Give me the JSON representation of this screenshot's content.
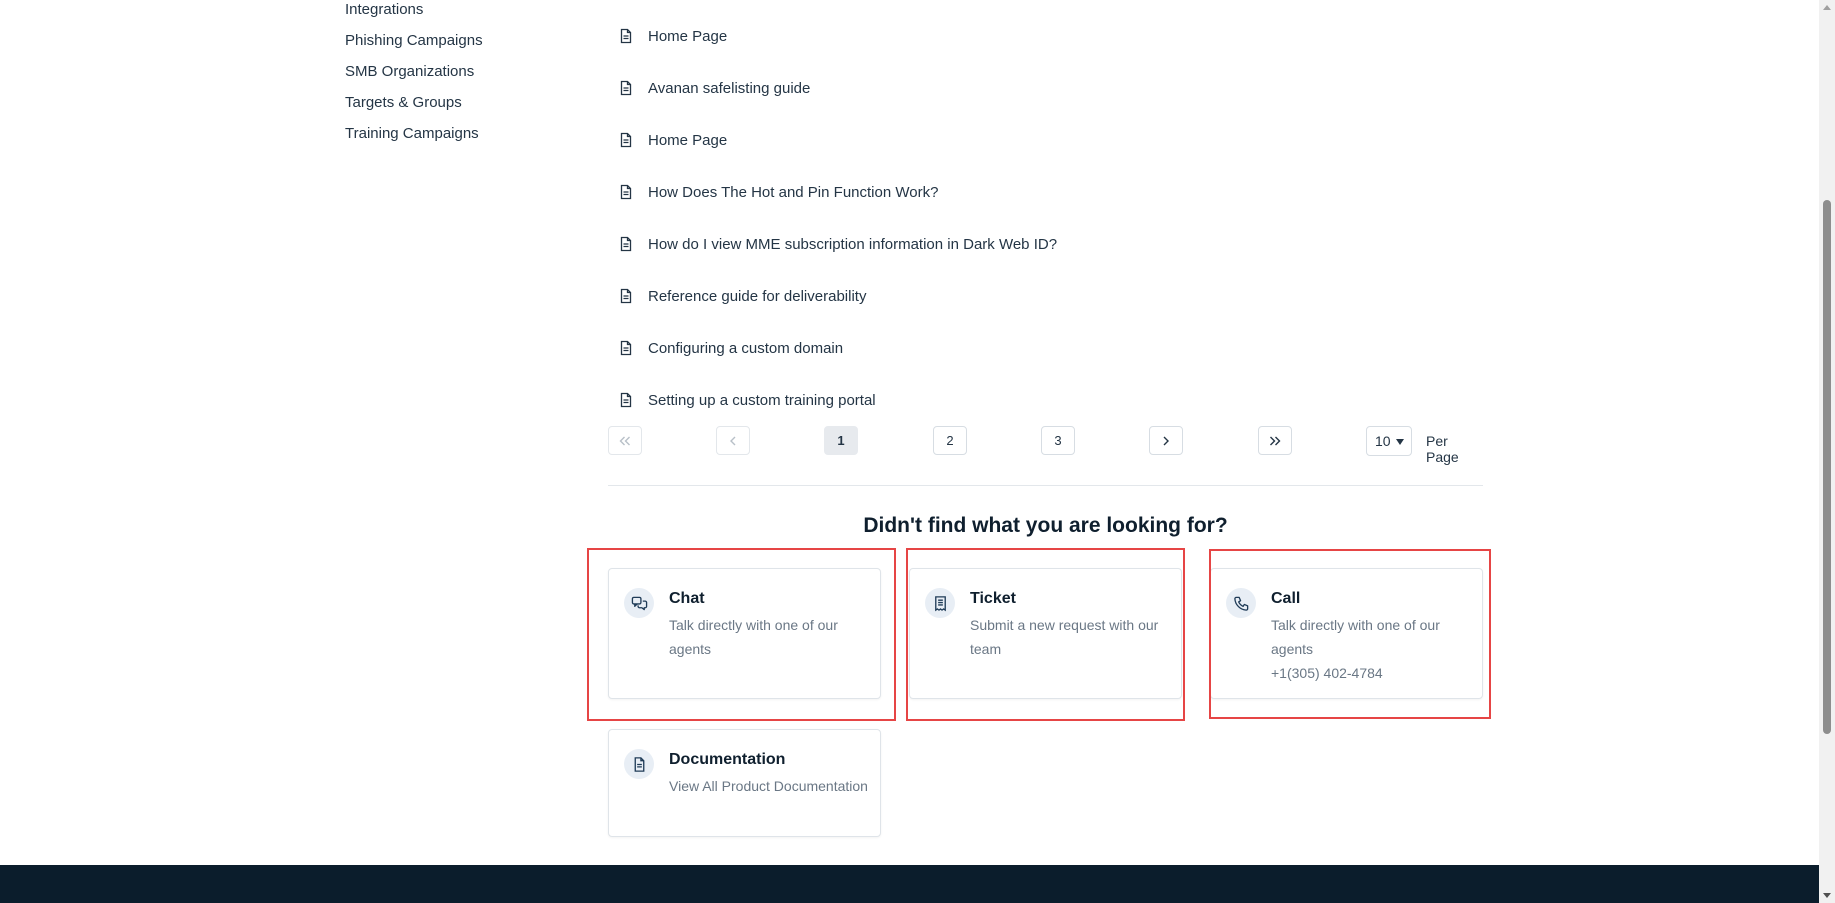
{
  "sidebar": {
    "items": [
      {
        "label": "Integrations"
      },
      {
        "label": "Phishing Campaigns"
      },
      {
        "label": "SMB Organizations"
      },
      {
        "label": "Targets & Groups"
      },
      {
        "label": "Training Campaigns"
      }
    ]
  },
  "articles": [
    {
      "title": "Home Page",
      "icon": "document-icon"
    },
    {
      "title": "Avanan safelisting guide",
      "icon": "document-icon"
    },
    {
      "title": "Home Page",
      "icon": "document-icon"
    },
    {
      "title": "How Does The Hot and Pin Function Work?",
      "icon": "document-icon"
    },
    {
      "title": "How do I view MME subscription information in Dark Web ID?",
      "icon": "document-icon"
    },
    {
      "title": "Reference guide for deliverability",
      "icon": "document-icon"
    },
    {
      "title": "Configuring a custom domain",
      "icon": "document-icon"
    },
    {
      "title": "Setting up a custom training portal",
      "icon": "document-icon"
    }
  ],
  "pagination": {
    "pages": [
      "1",
      "2",
      "3"
    ],
    "current": "1",
    "per_page_value": "10",
    "per_page_label": "Per Page"
  },
  "help": {
    "title": "Didn't find what you are looking for?",
    "cards": {
      "chat": {
        "title": "Chat",
        "desc": "Talk directly with one of our agents",
        "icon": "chat-bubbles-icon"
      },
      "ticket": {
        "title": "Ticket",
        "desc": "Submit a new request with our team",
        "icon": "ticket-icon"
      },
      "call": {
        "title": "Call",
        "desc": "Talk directly with one of our agents",
        "phone": "+1(305) 402-4784",
        "icon": "phone-icon"
      },
      "documentation": {
        "title": "Documentation",
        "desc": "View All Product Documentation",
        "icon": "document-icon"
      }
    }
  },
  "colors": {
    "highlight": "#e64545",
    "footer": "#0b1d2c",
    "icon_bg": "#e8eef5",
    "text_primary": "#0f1f2e",
    "text_muted": "#6a7785"
  }
}
